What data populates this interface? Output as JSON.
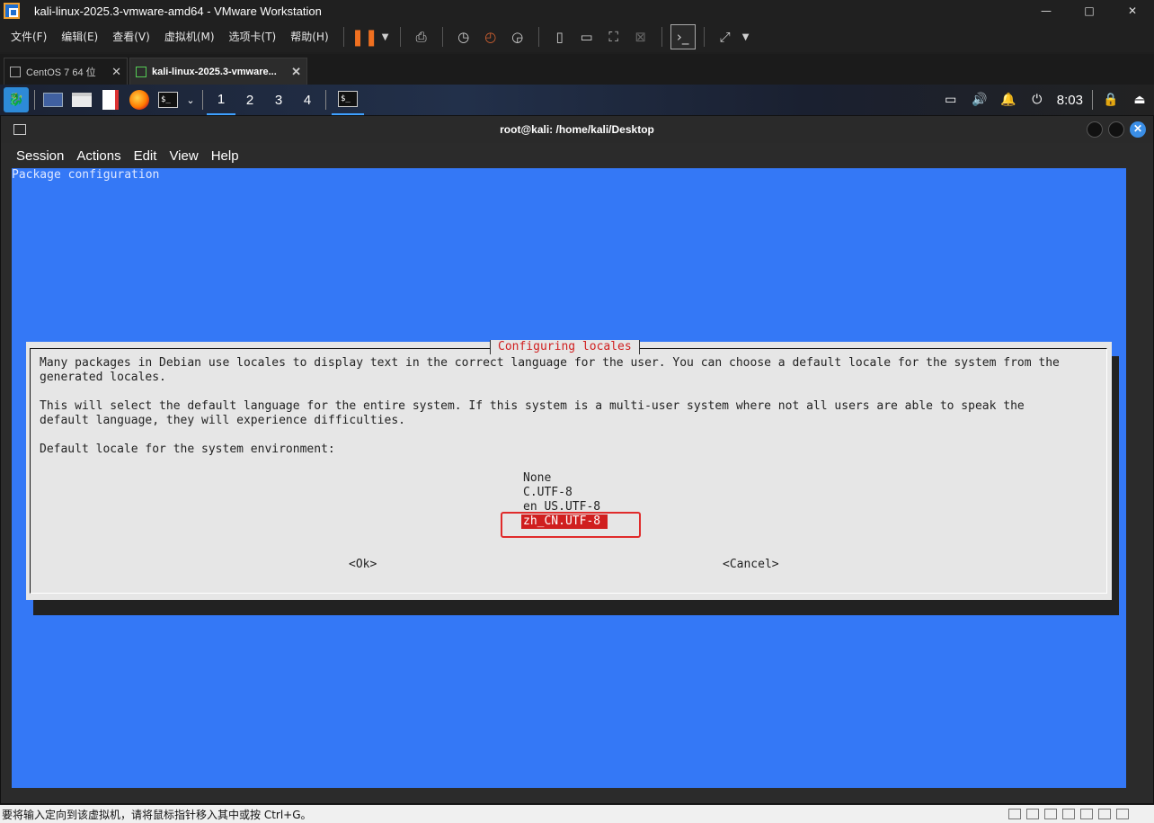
{
  "window": {
    "title": "kali-linux-2025.3-vmware-amd64 - VMware Workstation",
    "minimize": "—",
    "maximize": "□",
    "close": "✕"
  },
  "menubar": {
    "items": [
      "文件(F)",
      "编辑(E)",
      "查看(V)",
      "虚拟机(M)",
      "选项卡(T)",
      "帮助(H)"
    ]
  },
  "vm_tabs": [
    {
      "label": "CentOS 7 64 位",
      "active": false
    },
    {
      "label": "kali-linux-2025.3-vmware...",
      "active": true
    }
  ],
  "kali_panel": {
    "workspaces": [
      "1",
      "2",
      "3",
      "4"
    ],
    "active_workspace": "1",
    "clock": "8:03",
    "term_glyph": "$_"
  },
  "terminal": {
    "title": "root@kali: /home/kali/Desktop",
    "menu": [
      "Session",
      "Actions",
      "Edit",
      "View",
      "Help"
    ],
    "close_glyph": "✕"
  },
  "debconf": {
    "backtitle": "Package configuration",
    "dialog_title": "Configuring locales",
    "text_lines": [
      "Many packages in Debian use locales to display text in the correct language for the user. You can choose a default locale for the system from the",
      "generated locales.",
      "",
      "This will select the default language for the entire system. If this system is a multi-user system where not all users are able to speak the",
      "default language, they will experience difficulties.",
      "",
      "Default locale for the system environment:"
    ],
    "locales": [
      "None",
      "C.UTF-8",
      "en_US.UTF-8",
      "zh_CN.UTF-8"
    ],
    "selected_locale": "zh_CN.UTF-8",
    "ok": "<Ok>",
    "cancel": "<Cancel>"
  },
  "statusbar": {
    "text": "要将输入定向到该虚拟机，请将鼠标指针移入其中或按 Ctrl+G。"
  },
  "colors": {
    "screen_blue": "#3478f6",
    "dialog_bg": "#e6e6e6",
    "title_red": "#d01f1f",
    "highlight_red": "#e02b2b"
  }
}
